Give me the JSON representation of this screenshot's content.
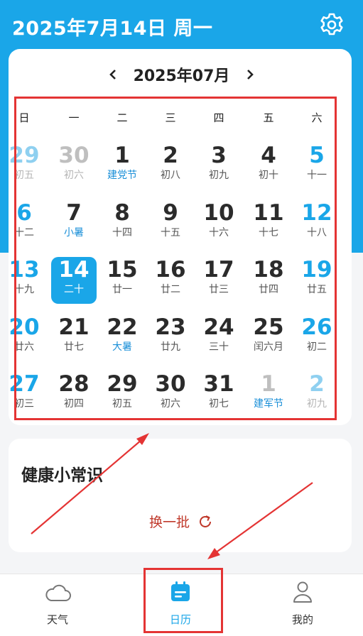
{
  "header": {
    "date_title": "2025年7月14日 周一"
  },
  "calendar": {
    "month_label": "2025年07月",
    "weekdays": [
      "日",
      "一",
      "二",
      "三",
      "四",
      "五",
      "六"
    ],
    "days": [
      {
        "n": "29",
        "l": "初五",
        "other": true
      },
      {
        "n": "30",
        "l": "初六",
        "other": true
      },
      {
        "n": "1",
        "l": "建党节",
        "fest": true
      },
      {
        "n": "2",
        "l": "初八"
      },
      {
        "n": "3",
        "l": "初九"
      },
      {
        "n": "4",
        "l": "初十"
      },
      {
        "n": "5",
        "l": "十一"
      },
      {
        "n": "6",
        "l": "十二"
      },
      {
        "n": "7",
        "l": "小暑",
        "fest": true
      },
      {
        "n": "8",
        "l": "十四"
      },
      {
        "n": "9",
        "l": "十五"
      },
      {
        "n": "10",
        "l": "十六"
      },
      {
        "n": "11",
        "l": "十七"
      },
      {
        "n": "12",
        "l": "十八"
      },
      {
        "n": "13",
        "l": "十九"
      },
      {
        "n": "14",
        "l": "二十",
        "today": true
      },
      {
        "n": "15",
        "l": "廿一"
      },
      {
        "n": "16",
        "l": "廿二"
      },
      {
        "n": "17",
        "l": "廿三"
      },
      {
        "n": "18",
        "l": "廿四"
      },
      {
        "n": "19",
        "l": "廿五"
      },
      {
        "n": "20",
        "l": "廿六"
      },
      {
        "n": "21",
        "l": "廿七"
      },
      {
        "n": "22",
        "l": "大暑",
        "fest": true
      },
      {
        "n": "23",
        "l": "廿九"
      },
      {
        "n": "24",
        "l": "三十"
      },
      {
        "n": "25",
        "l": "闰六月"
      },
      {
        "n": "26",
        "l": "初二"
      },
      {
        "n": "27",
        "l": "初三"
      },
      {
        "n": "28",
        "l": "初四"
      },
      {
        "n": "29",
        "l": "初五"
      },
      {
        "n": "30",
        "l": "初六"
      },
      {
        "n": "31",
        "l": "初七"
      },
      {
        "n": "1",
        "l": "建军节",
        "other": true,
        "fest": true
      },
      {
        "n": "2",
        "l": "初九",
        "other": true
      }
    ]
  },
  "health": {
    "title": "健康小常识",
    "refresh_label": "换一批"
  },
  "tabs": [
    {
      "label": "天气",
      "icon": "cloud-icon"
    },
    {
      "label": "日历",
      "icon": "calendar-icon",
      "active": true
    },
    {
      "label": "我的",
      "icon": "person-icon"
    }
  ],
  "colors": {
    "primary": "#1aa6e8",
    "annotation": "#e43434",
    "refresh": "#c0392b"
  }
}
